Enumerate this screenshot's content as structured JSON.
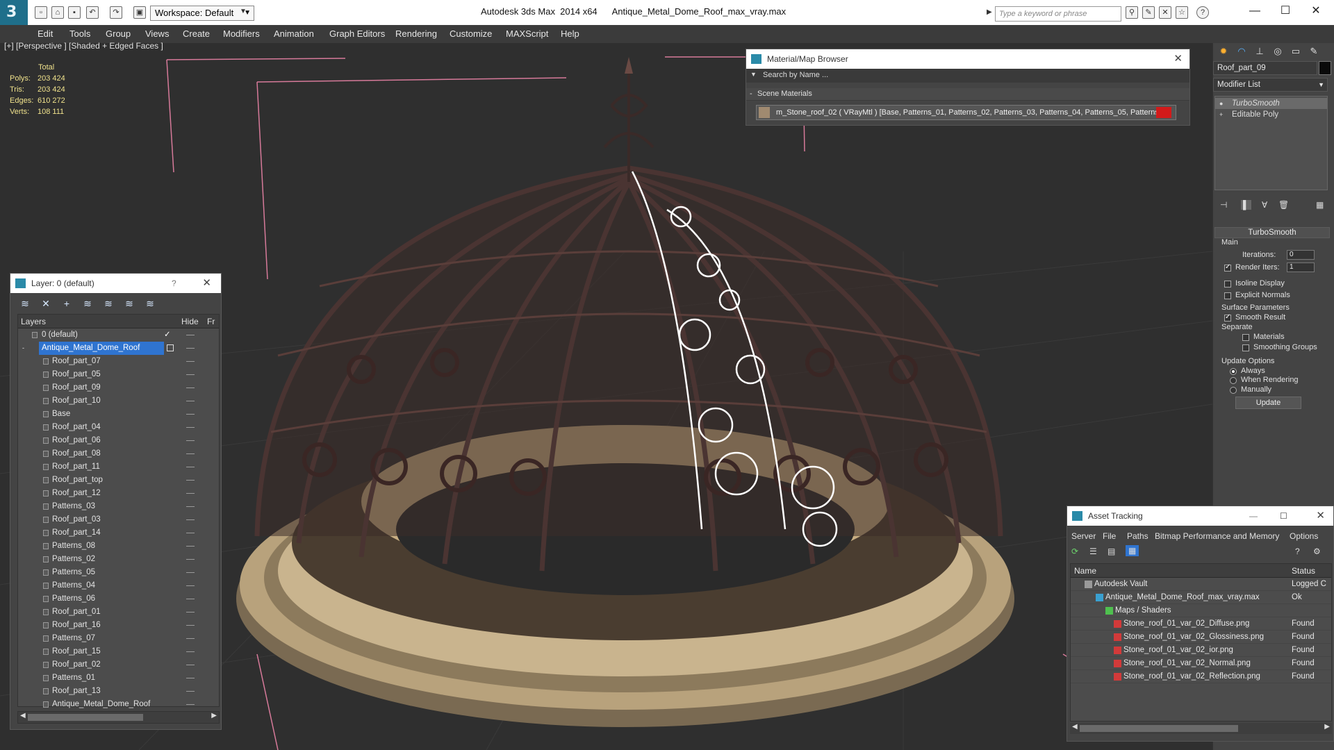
{
  "titlebar": {
    "workspace": "Workspace: Default",
    "app_title": "Autodesk 3ds Max  2014 x64",
    "file_title": "Antique_Metal_Dome_Roof_max_vray.max",
    "search_placeholder": "Type a keyword or phrase"
  },
  "menu": [
    "Edit",
    "Tools",
    "Group",
    "Views",
    "Create",
    "Modifiers",
    "Animation",
    "Graph Editors",
    "Rendering",
    "Customize",
    "MAXScript",
    "Help"
  ],
  "viewport": {
    "label": "[+] [Perspective ] [Shaded + Edged Faces ]",
    "stats": {
      "total_label": "Total",
      "rows": [
        {
          "label": "Polys:",
          "value": "203 424"
        },
        {
          "label": "Tris:",
          "value": "203 424"
        },
        {
          "label": "Edges:",
          "value": "610 272"
        },
        {
          "label": "Verts:",
          "value": "108 111"
        }
      ]
    }
  },
  "layer_dialog": {
    "title": "Layer: 0 (default)",
    "help": "?",
    "col_layers": "Layers",
    "col_hide": "Hide",
    "col_fr": "Fr",
    "default_layer": "0 (default)",
    "selected_layer": "Antique_Metal_Dome_Roof",
    "objects": [
      "Roof_part_07",
      "Roof_part_05",
      "Roof_part_09",
      "Roof_part_10",
      "Base",
      "Roof_part_04",
      "Roof_part_06",
      "Roof_part_08",
      "Roof_part_11",
      "Roof_part_top",
      "Roof_part_12",
      "Patterns_03",
      "Roof_part_03",
      "Roof_part_14",
      "Patterns_08",
      "Patterns_02",
      "Patterns_05",
      "Patterns_04",
      "Patterns_06",
      "Roof_part_01",
      "Roof_part_16",
      "Patterns_07",
      "Roof_part_15",
      "Roof_part_02",
      "Patterns_01",
      "Roof_part_13",
      "Antique_Metal_Dome_Roof"
    ]
  },
  "material_browser": {
    "title": "Material/Map Browser",
    "search_placeholder": "Search by Name ...",
    "section": "Scene Materials",
    "item": "m_Stone_roof_02  ( VRayMtl )  [Base, Patterns_01, Patterns_02, Patterns_03, Patterns_04, Patterns_05, Patterns..."
  },
  "command_panel": {
    "object_name": "Roof_part_09",
    "modifier_list": "Modifier List",
    "stack": [
      "TurboSmooth",
      "Editable Poly"
    ],
    "rollout_title": "TurboSmooth",
    "main_label": "Main",
    "iterations_label": "Iterations:",
    "iterations_value": "0",
    "render_iters_label": "Render Iters:",
    "render_iters_value": "1",
    "isoline": "Isoline Display",
    "explicit_normals": "Explicit Normals",
    "surface_params": "Surface Parameters",
    "smooth_result": "Smooth Result",
    "separate": "Separate",
    "materials": "Materials",
    "smoothing_groups": "Smoothing Groups",
    "update_options": "Update Options",
    "always": "Always",
    "when_rendering": "When Rendering",
    "manually": "Manually",
    "update_button": "Update"
  },
  "asset_tracking": {
    "title": "Asset Tracking",
    "menu": [
      "Server",
      "File",
      "Paths",
      "Bitmap Performance and Memory",
      "Options"
    ],
    "col_name": "Name",
    "col_status": "Status",
    "rows": [
      {
        "name": "Autodesk Vault",
        "status": "Logged C"
      },
      {
        "name": "Antique_Metal_Dome_Roof_max_vray.max",
        "status": "Ok"
      },
      {
        "name": "Maps / Shaders",
        "status": ""
      },
      {
        "name": "Stone_roof_01_var_02_Diffuse.png",
        "status": "Found"
      },
      {
        "name": "Stone_roof_01_var_02_Glossiness.png",
        "status": "Found"
      },
      {
        "name": "Stone_roof_01_var_02_ior.png",
        "status": "Found"
      },
      {
        "name": "Stone_roof_01_var_02_Normal.png",
        "status": "Found"
      },
      {
        "name": "Stone_roof_01_var_02_Reflection.png",
        "status": "Found"
      }
    ]
  }
}
